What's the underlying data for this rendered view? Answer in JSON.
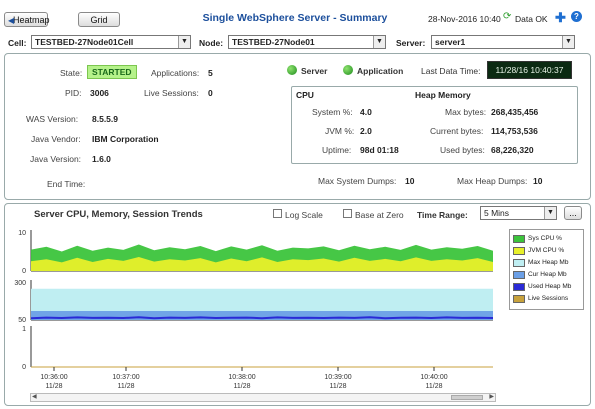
{
  "toolbar": {
    "heatmap_label": "Heatmap",
    "grid_label": "Grid"
  },
  "header": {
    "title": "Single WebSphere Server - Summary",
    "datetime": "28-Nov-2016 10:40",
    "data_status": "Data OK"
  },
  "filters": {
    "cell_label": "Cell:",
    "cell_value": "TESTBED-27Node01Cell",
    "node_label": "Node:",
    "node_value": "TESTBED-27Node01",
    "server_label": "Server:",
    "server_value": "server1"
  },
  "summary": {
    "state_label": "State:",
    "state_value": "STARTED",
    "applications_label": "Applications:",
    "applications_value": "5",
    "pid_label": "PID:",
    "pid_value": "3006",
    "sessions_label": "Live Sessions:",
    "sessions_value": "0",
    "was_version_label": "WAS Version:",
    "was_version_value": "8.5.5.9",
    "vendor_label": "Java Vendor:",
    "vendor_value": "IBM Corporation",
    "java_version_label": "Java Version:",
    "java_version_value": "1.6.0",
    "end_time_label": "End Time:",
    "server_status_label": "Server",
    "application_status_label": "Application",
    "last_data_label": "Last Data Time:",
    "last_data_value": "11/28/16 10:40:37",
    "cpu_title": "CPU",
    "heap_title": "Heap Memory",
    "system_pct_label": "System %:",
    "system_pct_value": "4.0",
    "jvm_pct_label": "JVM %:",
    "jvm_pct_value": "2.0",
    "uptime_label": "Uptime:",
    "uptime_value": "98d 01:18",
    "max_bytes_label": "Max bytes:",
    "max_bytes_value": "268,435,456",
    "current_bytes_label": "Current bytes:",
    "current_bytes_value": "114,753,536",
    "used_bytes_label": "Used bytes:",
    "used_bytes_value": "68,226,320",
    "max_sys_dumps_label": "Max System Dumps:",
    "max_sys_dumps_value": "10",
    "max_heap_dumps_label": "Max Heap Dumps:",
    "max_heap_dumps_value": "10"
  },
  "trends": {
    "title": "Server CPU, Memory, Session Trends",
    "log_scale_label": "Log Scale",
    "base_zero_label": "Base at Zero",
    "time_range_label": "Time Range:",
    "time_range_value": "5 Mins",
    "more_button": "..."
  },
  "colors": {
    "title": "#1c4f9c",
    "started": "#b5f28a",
    "sys_cpu": "#3cc43c",
    "jvm_cpu": "#e8f02a",
    "max_heap": "#bfeef2",
    "cur_heap": "#6b9fe6",
    "used_heap": "#2a2ad6",
    "live_sessions": "#c8a23c",
    "last_data_bg": "#0b2a12"
  },
  "chart_data": {
    "type": "area",
    "x_ticks": [
      {
        "time": "10:36:00",
        "date": "11/28"
      },
      {
        "time": "10:37:00",
        "date": "11/28"
      },
      {
        "time": "10:38:00",
        "date": "11/28"
      },
      {
        "time": "10:39:00",
        "date": "11/28"
      },
      {
        "time": "10:40:00",
        "date": "11/28"
      }
    ],
    "panels": [
      {
        "ylim": [
          0,
          10
        ],
        "y_ticks": [
          "10",
          "0"
        ],
        "series": [
          {
            "name": "Sys CPU %",
            "values": [
              5.5,
              6.2,
              5.0,
              6.5,
              5.2,
              6.0,
              5.4,
              6.8,
              5.3,
              6.1,
              5.6,
              6.4,
              5.1,
              6.3,
              5.5,
              6.6,
              5.2,
              6.0,
              5.8,
              6.3,
              5.3,
              6.5,
              5.6,
              6.2,
              5.4,
              6.7,
              5.5,
              6.1,
              5.7,
              6.4,
              5.2
            ]
          },
          {
            "name": "JVM CPU %",
            "values": [
              2.5,
              3.0,
              2.2,
              3.4,
              2.3,
              3.1,
              2.6,
              3.6,
              2.4,
              3.0,
              2.7,
              3.3,
              2.2,
              3.2,
              2.5,
              3.5,
              2.3,
              3.0,
              2.8,
              3.2,
              2.4,
              3.4,
              2.6,
              3.1,
              2.5,
              3.5,
              2.6,
              3.0,
              2.7,
              3.3,
              2.3
            ]
          }
        ]
      },
      {
        "ylim": [
          50,
          300
        ],
        "y_ticks": [
          "300",
          "50"
        ],
        "series": [
          {
            "name": "Max Heap Mb",
            "values": [
              256,
              256
            ]
          },
          {
            "name": "Cur Heap Mb",
            "values": [
              109,
              109
            ]
          },
          {
            "name": "Used Heap Mb",
            "values": [
              62,
              66,
              63,
              67,
              64,
              65,
              63,
              68,
              62,
              66,
              64,
              67,
              63,
              65,
              66,
              62,
              67,
              64,
              65,
              63,
              66,
              64,
              68,
              62,
              65,
              66,
              63,
              67,
              64,
              65,
              63
            ]
          }
        ]
      },
      {
        "ylim": [
          0,
          1
        ],
        "y_ticks": [
          "1",
          "0"
        ],
        "series": [
          {
            "name": "Live Sessions",
            "values": [
              0,
              0
            ]
          }
        ]
      }
    ],
    "legend": [
      "Sys CPU %",
      "JVM CPU %",
      "Max Heap Mb",
      "Cur Heap Mb",
      "Used Heap Mb",
      "Live Sessions"
    ]
  }
}
